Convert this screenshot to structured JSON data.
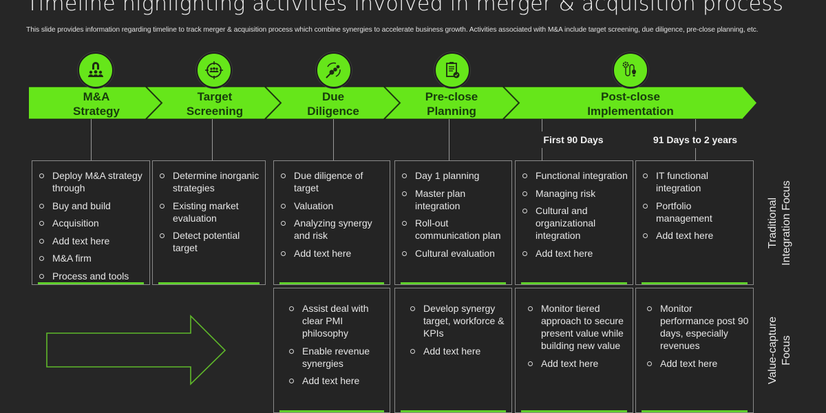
{
  "slide": {
    "title": "Timeline highlighting activities involved in merger & acquisition process",
    "subtitle": "This slide provides information regarding timeline to track merger & acquisition process which combine synergies to accelerate business growth. Activities associated with M&A include target screening, due diligence, pre-close planning, etc."
  },
  "colors": {
    "accent": "#66e61a",
    "background": "#262626",
    "stage_text": "#173d0c"
  },
  "stages": [
    {
      "line1": "M&A",
      "line2": "Strategy",
      "icon": "magnet-people-icon"
    },
    {
      "line1": "Target",
      "line2": "Screening",
      "icon": "target-group-icon"
    },
    {
      "line1": "Due",
      "line2": "Diligence",
      "icon": "dollar-gears-icon"
    },
    {
      "line1": "Pre-close",
      "line2": "Planning",
      "icon": "clipboard-check-icon"
    },
    {
      "line1": "Post-close",
      "line2": "Implementation",
      "icon": "gear-bulb-icon"
    }
  ],
  "phases": [
    "First 90 Days",
    "91 Days to 2 years"
  ],
  "side_labels": {
    "traditional": [
      "Traditional",
      "Integration Focus"
    ],
    "value": [
      "Value-capture",
      "Focus"
    ]
  },
  "traditional_focus": [
    [
      "Deploy M&A strategy through",
      "Buy and build",
      "Acquisition",
      "Add text here",
      "M&A firm",
      "Process and tools"
    ],
    [
      "Determine inorganic strategies",
      "Existing market evaluation",
      "Detect potential target"
    ],
    [
      "Due diligence of target",
      "Valuation",
      "Analyzing synergy and risk",
      "Add text here"
    ],
    [
      "Day 1 planning",
      "Master plan integration",
      "Roll-out communication plan",
      "Cultural evaluation"
    ],
    [
      "Functional integration",
      "Managing risk",
      "Cultural and organizational integration",
      "Add text here"
    ],
    [
      "IT functional integration",
      "Portfolio management",
      "Add text here"
    ]
  ],
  "value_capture_focus": [
    [
      "Assist deal with clear PMI philosophy",
      "Enable revenue synergies",
      "Add text here"
    ],
    [
      "Develop synergy target, workforce & KPIs",
      "Add text here"
    ],
    [
      "Monitor tiered approach to secure present value while building new value",
      "Add text here"
    ],
    [
      "Monitor performance post 90 days, especially revenues",
      "Add text here"
    ]
  ]
}
